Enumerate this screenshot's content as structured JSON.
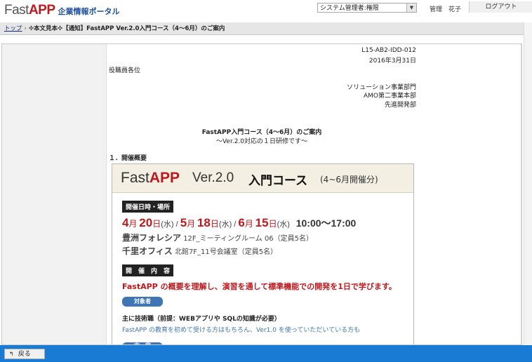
{
  "header": {
    "logo_fast": "Fast",
    "logo_app": "APP",
    "logo_sub": "企業情報ポータル",
    "role_select": "システム管理者:権限",
    "user_name": "管理　花子",
    "logout_label": "ログアウト"
  },
  "breadcrumb": {
    "top": "トップ",
    "arrow": "›",
    "current": "✣本文見本✣【通知】FastAPP Ver.2.0入門コース（4～6月）のご案内"
  },
  "document": {
    "doc_id": "L15-AB2-IDD-012",
    "date": "2016年3月31日",
    "addressee": "役職員各位",
    "dept1": "ソリューション事業部門",
    "dept2": "AMO第二事業本部",
    "dept3": "先進開発部",
    "title": "FastAPP入門コース（4～6月）のご案内",
    "subtitle": "～Ver.2.0対応の１日研修です～",
    "section1": "１．開催概要"
  },
  "poster": {
    "fast": "Fast",
    "app": "APP",
    "version": "Ver.2.0",
    "course": "入門コース",
    "period": "(4~6月開催分)",
    "tag_datetime": "開催日時・場所",
    "dates": [
      {
        "month": "4",
        "day": "20",
        "dow": "(水)",
        "sep": " / "
      },
      {
        "month": "5",
        "day": "18",
        "dow": "(水)",
        "sep": " / "
      },
      {
        "month": "6",
        "day": "15",
        "dow": "(水)",
        "sep": ""
      }
    ],
    "month_unit": "月",
    "day_unit": "日",
    "time": "10:00～17:00",
    "venue1_name": "豊洲フォレシア",
    "venue1_detail": " 12F_ミーティングルーム 06（定員5名）",
    "venue2_name": "千里オフィス",
    "venue2_detail": " 北館7F_11号会議室（定員5名）",
    "tag_content": "開　催　内　容",
    "summary": "FastAPP の概要を理解し、演習を通して標準機能での開発を1日で学びます。",
    "tag_target": "対象者",
    "target_main": "主に技術職（前提：WEBアプリや SQLの知識が必要）",
    "target_sub": "FastAPP の教育を初めて受ける方はもちろん、Ver1.0 を使っていただいている方も",
    "tag_next": "内　容"
  },
  "footer": {
    "back_label": "戻る"
  },
  "colors": {
    "accent_red": "#c0181c",
    "footer_blue": "#1a7bd4",
    "tag_blue": "#3f75b5"
  }
}
